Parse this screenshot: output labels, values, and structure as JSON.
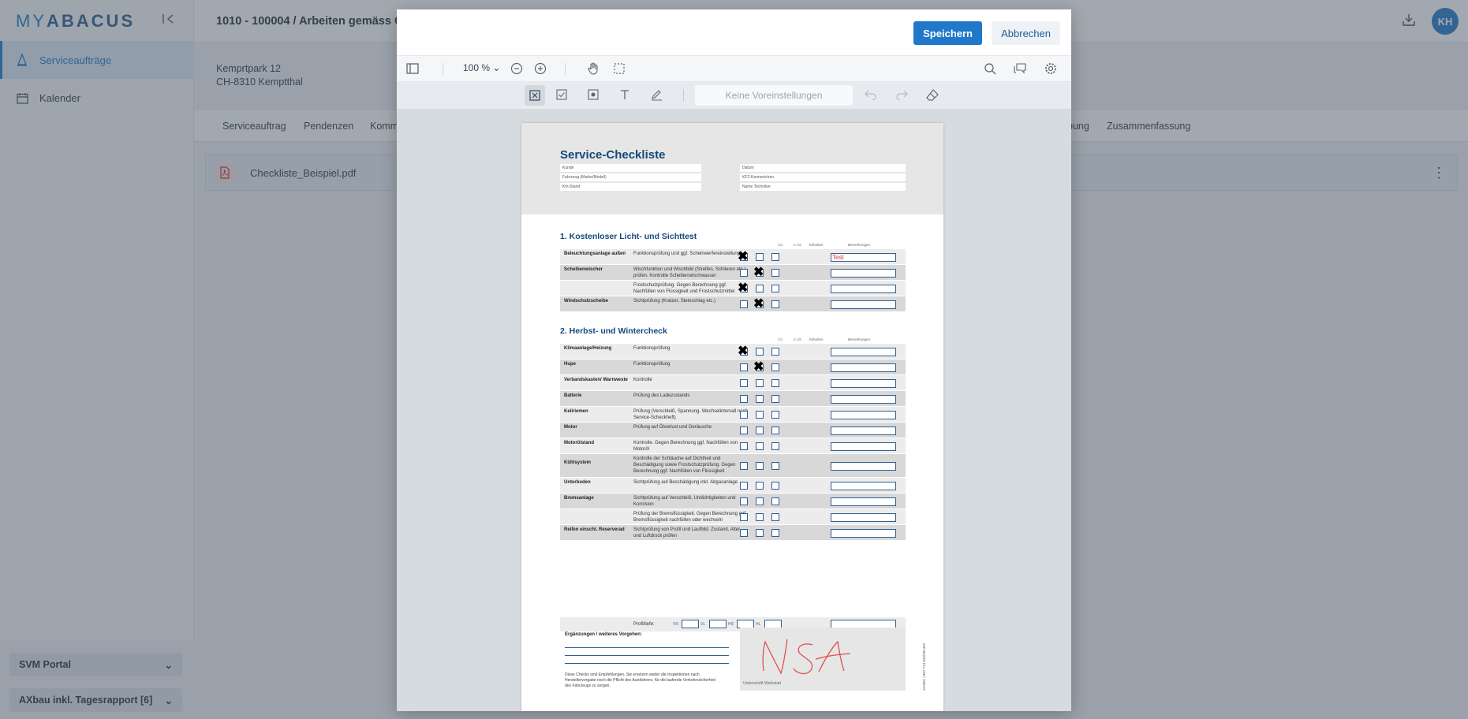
{
  "app": {
    "logo_my": "MY",
    "logo_rest": "ABACUS"
  },
  "sidebar": {
    "items": [
      {
        "label": "Serviceaufträge",
        "icon": "cone-icon"
      },
      {
        "label": "Kalender",
        "icon": "calendar-icon"
      }
    ],
    "bottom": [
      {
        "label": "SVM Portal"
      },
      {
        "label": "AXbau inkl. Tagesrapport [6]"
      }
    ]
  },
  "header": {
    "title": "1010 - 100004 / Arbeiten gemäss C",
    "avatar": "KH"
  },
  "address": {
    "line1": "Kemprtpark 12",
    "line2": "CH-8310 Kemptthal"
  },
  "tabs": [
    "Serviceauftrag",
    "Pendenzen",
    "Komm",
    "bung",
    "Zusammenfassung"
  ],
  "file": {
    "name": "Checkliste_Beispiel.pdf"
  },
  "modal": {
    "save": "Speichern",
    "cancel": "Abbrechen",
    "zoom": "100 %",
    "preset": "Keine Voreinstellungen"
  },
  "doc": {
    "title": "Service-Checkliste",
    "head_fields": [
      "Kunde",
      "Fahrzeug (Marke/Modell)",
      "Km-Stand",
      "Datum",
      "KFZ-Kennzeichen",
      "Name Techniker"
    ],
    "col_heads": [
      "i.O.",
      "n.i.O.",
      "behoben",
      "Bemerkungen"
    ],
    "section1": {
      "title": "1. Kostenloser Licht- und Sichttest",
      "rows": [
        {
          "label": "Beleuchtungsanlage außen",
          "desc": "Funktionsprüfung und ggf. Scheinwerfereinstellung",
          "checked": "io",
          "remark": "Test"
        },
        {
          "label": "Scheibenwischer",
          "desc": "Wischfunktion und Wischbild (Streifen, Schlieren etc.) prüfen. Kontrolle Scheibenwischwasser",
          "checked": "nio",
          "remark": ""
        },
        {
          "label": "",
          "desc": "Frostschutzprüfung. Gegen Berechnung ggf. Nachfüllen von Flüssigkeit und Frostschutzmittel",
          "checked": "io",
          "remark": ""
        },
        {
          "label": "Windschutzscheibe",
          "desc": "Sichtprüfung (Kratzer, Steinschlag etc.)",
          "checked": "nio",
          "remark": ""
        }
      ]
    },
    "section2": {
      "title": "2. Herbst- und Wintercheck",
      "rows": [
        {
          "label": "Klimaanlage/Heizung",
          "desc": "Funktionsprüfung",
          "checked": "io"
        },
        {
          "label": "Hupe",
          "desc": "Funktionsprüfung",
          "checked": "nio"
        },
        {
          "label": "Verbandskasten/ Warnweste",
          "desc": "Kontrolle",
          "checked": ""
        },
        {
          "label": "Batterie",
          "desc": "Prüfung des Ladezustands",
          "checked": ""
        },
        {
          "label": "Keilriemen",
          "desc": "Prüfung (Verschleiß, Spannung, Wechselintervall nach Service-Scheckheft)",
          "checked": ""
        },
        {
          "label": "Motor",
          "desc": "Prüfung auf Ölverlust und Geräusche",
          "checked": ""
        },
        {
          "label": "Motorölstand",
          "desc": "Kontrolle. Gegen Berechnung ggf. Nachfüllen von Motoröl",
          "checked": ""
        },
        {
          "label": "Kühlsystem",
          "desc": "Kontrolle der Schläuche auf Dichtheit und Beschädigung sowie Frostschutzprüfung. Gegen Berechnung ggf. Nachfüllen von Flüssigkeit",
          "checked": ""
        },
        {
          "label": "Unterboden",
          "desc": "Sichtprüfung auf Beschädigung inkl. Abgasanlage",
          "checked": ""
        },
        {
          "label": "Bremsanlage",
          "desc": "Sichtprüfung auf Verschleiß, Undichtigkeiten und Korrosion",
          "checked": ""
        },
        {
          "label": "",
          "desc": "Prüfung der Bremsflüssigkeit. Gegen Berechnung ggf. Bremsflüssigkeit nachfüllen oder wechseln",
          "checked": ""
        },
        {
          "label": "Reifen einschl. Reserverad",
          "desc": "Sichtprüfung von Profil und Laufbild. Zustand, Alter und Luftdruck prüfen",
          "checked": ""
        }
      ],
      "profile": {
        "label": "Profiltiefe:",
        "fields": [
          "VR",
          "VL",
          "HR",
          "HL"
        ]
      }
    },
    "extras_label": "Ergänzungen / weiteres Vorgehen:",
    "disclaimer": "Diese Checks sind Empfehlungen. Sie ersetzen weder die Inspektionen nach Herstellervorgabe noch die Pflicht des Autofahrers, für die laufende Verkehrssicherheit des Fahrzeugs zu sorgen.",
    "signature_label": "Unterschrift Werkstatt",
    "signature_text": "NSA",
    "vertical_code": "AXSEC | 987 714 832/201407"
  },
  "colors": {
    "accent": "#1f78c8",
    "doc_blue": "#14497a",
    "signature": "#e05050"
  }
}
